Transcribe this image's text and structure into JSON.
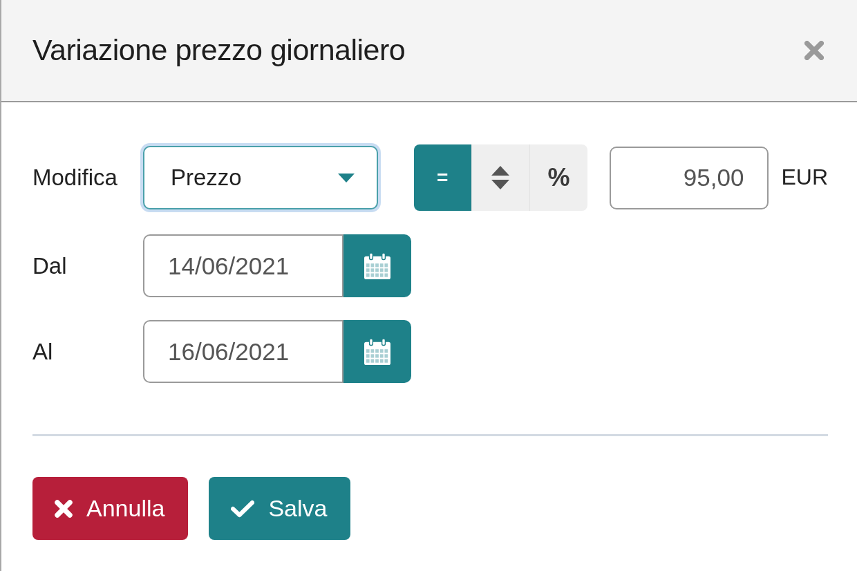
{
  "dialog": {
    "title": "Variazione prezzo giornaliero"
  },
  "form": {
    "modify": {
      "label": "Modifica",
      "select_value": "Prezzo",
      "focused": true,
      "mode_options": [
        {
          "kind": "text",
          "label": "=",
          "selected": true
        },
        {
          "kind": "icon",
          "selected": false
        },
        {
          "kind": "text",
          "label": "%",
          "selected": false
        }
      ],
      "amount": "95,00",
      "unit": "EUR"
    },
    "date_fields": [
      {
        "label": "Dal",
        "value": "14/06/2021"
      },
      {
        "label": "Al",
        "value": "16/06/2021"
      }
    ]
  },
  "buttons": [
    {
      "kind": "cancel",
      "label": "Annulla"
    },
    {
      "kind": "save",
      "label": "Salva"
    }
  ]
}
